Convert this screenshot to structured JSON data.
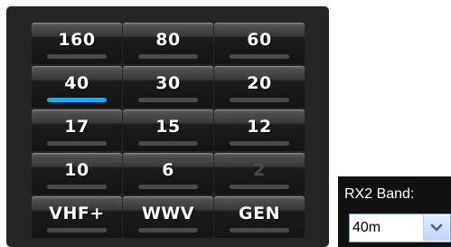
{
  "band_panel": {
    "buttons": [
      {
        "label": "160",
        "selected": false,
        "enabled": true
      },
      {
        "label": "80",
        "selected": false,
        "enabled": true
      },
      {
        "label": "60",
        "selected": false,
        "enabled": true
      },
      {
        "label": "40",
        "selected": true,
        "enabled": true
      },
      {
        "label": "30",
        "selected": false,
        "enabled": true
      },
      {
        "label": "20",
        "selected": false,
        "enabled": true
      },
      {
        "label": "17",
        "selected": false,
        "enabled": true
      },
      {
        "label": "15",
        "selected": false,
        "enabled": true
      },
      {
        "label": "12",
        "selected": false,
        "enabled": true
      },
      {
        "label": "10",
        "selected": false,
        "enabled": true
      },
      {
        "label": "6",
        "selected": false,
        "enabled": true
      },
      {
        "label": "2",
        "selected": false,
        "enabled": false
      },
      {
        "label": "VHF+",
        "selected": false,
        "enabled": true
      },
      {
        "label": "WWV",
        "selected": false,
        "enabled": true
      },
      {
        "label": "GEN",
        "selected": false,
        "enabled": true
      }
    ],
    "selected_color": "#1fa9ec",
    "indicator_color": "#4a4a4a",
    "disabled_text_color": "#4c4c4c"
  },
  "rx2": {
    "label": "RX2 Band:",
    "value": "40m",
    "dropdown_icon": "chevron-down-icon"
  }
}
